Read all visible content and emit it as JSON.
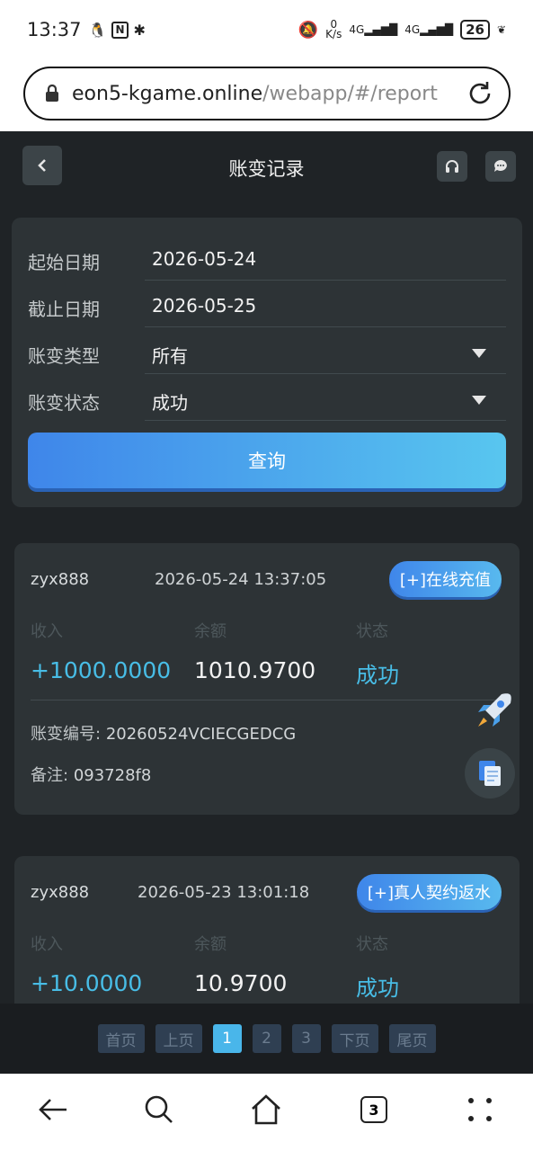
{
  "status": {
    "time": "13:37",
    "speed_top": "0",
    "speed_bottom": "K/s",
    "net1": "4G",
    "net2": "4G",
    "battery": "26"
  },
  "browser": {
    "url_host": "eon5-kgame.online",
    "url_path": "/webapp/#/report",
    "tab_count": "3"
  },
  "header": {
    "title": "账变记录"
  },
  "filter": {
    "start_label": "起始日期",
    "start_value": "2026-05-24",
    "end_label": "截止日期",
    "end_value": "2026-05-25",
    "type_label": "账变类型",
    "type_value": "所有",
    "status_label": "账变状态",
    "status_value": "成功",
    "query_label": "查询"
  },
  "records": [
    {
      "user": "zyx888",
      "time": "2026-05-24 13:37:05",
      "tag": "[+]在线充值",
      "income_label": "收入",
      "balance_label": "余额",
      "status_label": "状态",
      "income": "+1000.0000",
      "balance": "1010.9700",
      "status": "成功",
      "id_label": "账变编号:",
      "id": "20260524VCIECGEDCG",
      "note_label": "备注:",
      "note": "093728f8"
    },
    {
      "user": "zyx888",
      "time": "2026-05-23 13:01:18",
      "tag": "[+]真人契约返水",
      "income_label": "收入",
      "balance_label": "余额",
      "status_label": "状态",
      "income": "+10.0000",
      "balance": "10.9700",
      "status": "成功"
    }
  ],
  "pager": {
    "first": "首页",
    "prev": "上页",
    "pages": [
      "1",
      "2",
      "3"
    ],
    "next": "下页",
    "last": "尾页"
  },
  "colors": {
    "background": "#1f2326",
    "card": "#2d3336",
    "accent": "#48bde6",
    "button_start": "#3f86ea",
    "button_end": "#58c6ef"
  },
  "icons": {
    "back": "chevron-left-icon",
    "support": "headset-icon",
    "chat": "chat-bubble-icon",
    "rocket": "rocket-icon",
    "doc": "document-icon"
  }
}
